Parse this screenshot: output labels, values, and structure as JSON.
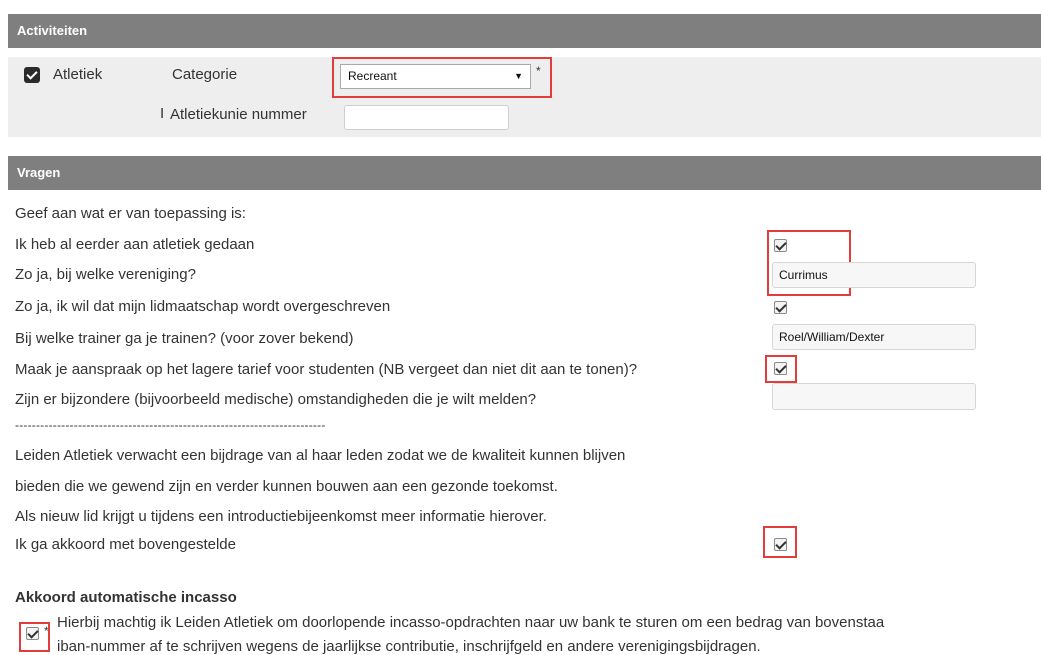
{
  "activities": {
    "header": "Activiteiten",
    "atletiek_label": "Atletiek",
    "category_label": "Categorie",
    "category_value": "Recreant",
    "required_marker": "*",
    "athletics_number_label": "Atletiekunie nummer",
    "athletics_number_value": ""
  },
  "questions": {
    "header": "Vragen",
    "intro": "Geef aan wat er van toepassing is:",
    "q1": "Ik heb al eerder aan atletiek gedaan",
    "q2": "Zo ja, bij welke vereniging?",
    "q2_value": "Currimus",
    "q3": "Zo ja, ik wil dat mijn lidmaatschap wordt overgeschreven",
    "q4": "Bij welke trainer ga je trainen? (voor zover bekend)",
    "q4_value": "Roel/William/Dexter",
    "q5": "Maak je aanspraak op het lagere tarief voor studenten (NB vergeet dan niet dit aan te tonen)?",
    "q6": "Zijn er bijzondere (bijvoorbeeld medische) omstandigheden die je wilt melden?",
    "q6_value": "",
    "divider": "--------------------------------------------------------------------------",
    "contrib_1": "Leiden Atletiek verwacht een bijdrage van al haar leden zodat we de kwaliteit kunnen blijven",
    "contrib_2": "bieden die we gewend zijn en verder kunnen bouwen aan een gezonde toekomst.",
    "contrib_3": "Als nieuw lid krijgt u tijdens een introductiebijeenkomst meer informatie hierover.",
    "agree": "Ik ga akkoord met bovengestelde"
  },
  "incasso": {
    "title": "Akkoord automatische incasso",
    "line1": "Hierbij machtig ik Leiden Atletiek om doorlopende incasso-opdrachten naar uw bank te sturen om een bedrag van bovenstaa",
    "line2": "iban-nummer af te schrijven wegens de jaarlijkse contributie, inschrijfgeld en andere verenigingsbijdragen.",
    "required_marker": "*"
  },
  "colors": {
    "header_bg": "#7f7f7f",
    "highlight": "#e23d3d",
    "panel_bg": "#eeeeee"
  }
}
